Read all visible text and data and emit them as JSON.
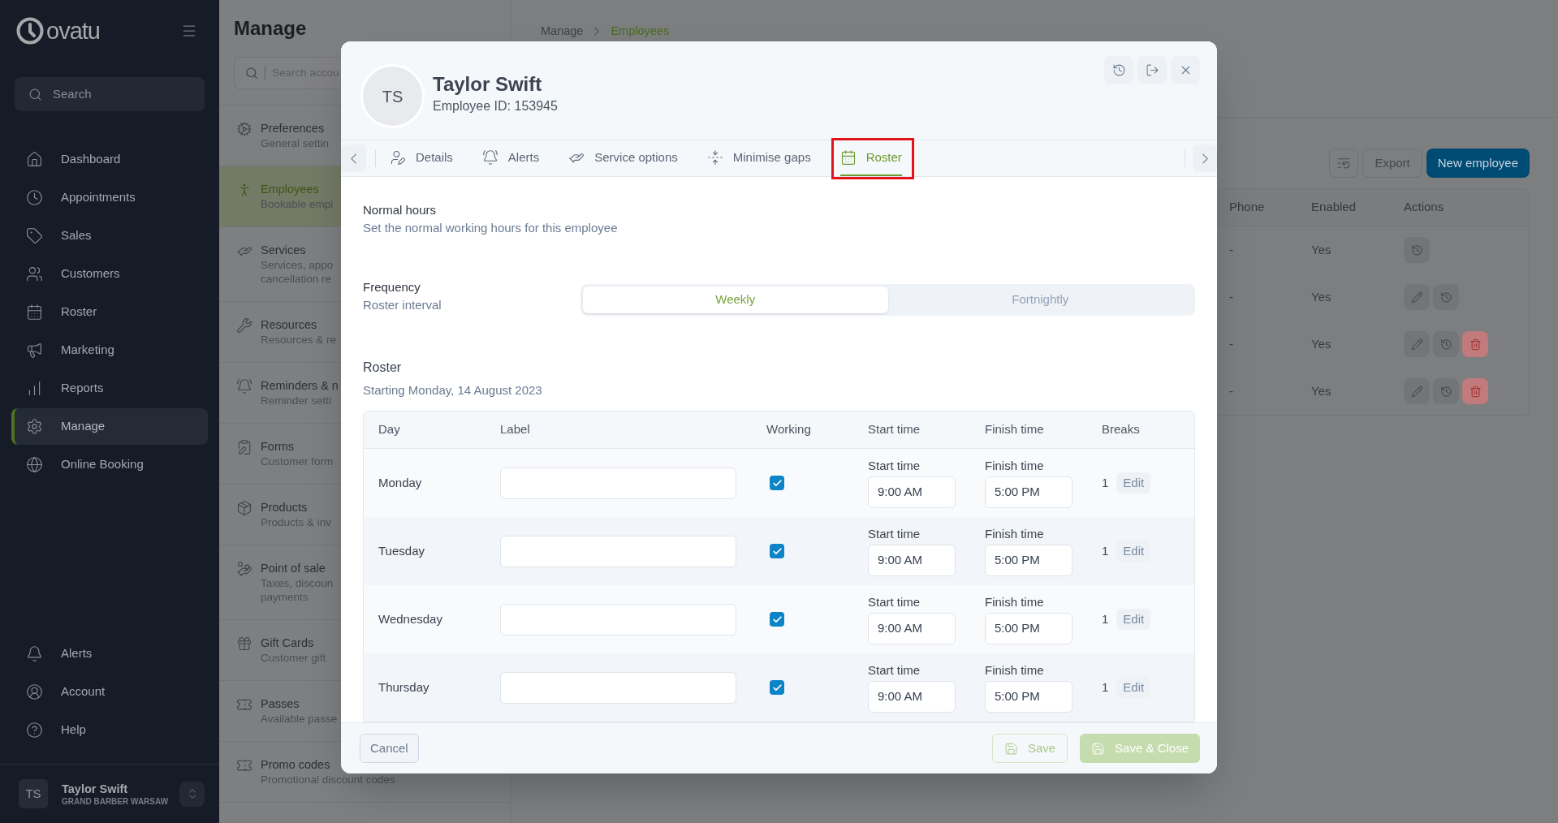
{
  "sidebar": {
    "logo_text": "ovatu",
    "search": {
      "placeholder": "Search"
    },
    "nav_items": [
      {
        "label": "Dashboard",
        "selected": false
      },
      {
        "label": "Appointments",
        "selected": false
      },
      {
        "label": "Sales",
        "selected": false
      },
      {
        "label": "Customers",
        "selected": false
      },
      {
        "label": "Roster",
        "selected": false
      },
      {
        "label": "Marketing",
        "selected": false
      },
      {
        "label": "Reports",
        "selected": false
      },
      {
        "label": "Manage",
        "selected": true
      },
      {
        "label": "Online Booking",
        "selected": false
      }
    ],
    "bottom_items": [
      {
        "label": "Alerts"
      },
      {
        "label": "Account"
      },
      {
        "label": "Help"
      }
    ],
    "user": {
      "initials": "TS",
      "name": "Taylor Swift",
      "business": "GRAND BARBER WARSAW"
    }
  },
  "manage_panel": {
    "title": "Manage",
    "search": {
      "placeholder": "Search accou"
    },
    "items": [
      {
        "title": "Preferences",
        "description": [
          "General settin"
        ],
        "selected": false
      },
      {
        "title": "Employees",
        "description": [
          "Bookable empl"
        ],
        "selected": true
      },
      {
        "title": "Services",
        "description": [
          "Services, appo",
          "cancellation re"
        ],
        "selected": false
      },
      {
        "title": "Resources",
        "description": [
          "Resources & re"
        ],
        "selected": false
      },
      {
        "title": "Reminders & n",
        "description": [
          "Reminder setti"
        ],
        "selected": false
      },
      {
        "title": "Forms",
        "description": [
          "Customer form"
        ],
        "selected": false
      },
      {
        "title": "Products",
        "description": [
          "Products & inv"
        ],
        "selected": false
      },
      {
        "title": "Point of sale",
        "description": [
          "Taxes, discoun",
          "payments"
        ],
        "selected": false
      },
      {
        "title": "Gift Cards",
        "description": [
          "Customer gift"
        ],
        "selected": false
      },
      {
        "title": "Passes",
        "description": [
          "Available passe"
        ],
        "selected": false
      },
      {
        "title": "Promo codes",
        "description": [
          "Promotional discount codes"
        ],
        "selected": false
      }
    ]
  },
  "main": {
    "breadcrumb": [
      {
        "label": "Manage",
        "current": false
      },
      {
        "label": "Employees",
        "current": true
      }
    ],
    "toolbar": [
      {
        "kind": "icon"
      },
      {
        "kind": "outline",
        "label": "Export"
      },
      {
        "kind": "primary",
        "label": "New employee"
      }
    ],
    "table": {
      "columns": [
        "Phone",
        "Enabled",
        "Actions"
      ],
      "rows": [
        {
          "phone": "-",
          "enabled": "Yes",
          "actions": [
            {
              "kind": "history"
            }
          ]
        },
        {
          "phone": "-",
          "enabled": "Yes",
          "actions": [
            {
              "kind": "edit"
            },
            {
              "kind": "history"
            }
          ]
        },
        {
          "phone": "-",
          "enabled": "Yes",
          "actions": [
            {
              "kind": "edit"
            },
            {
              "kind": "history"
            },
            {
              "kind": "delete"
            }
          ]
        },
        {
          "phone": "-",
          "enabled": "Yes",
          "actions": [
            {
              "kind": "edit"
            },
            {
              "kind": "history"
            },
            {
              "kind": "delete"
            }
          ]
        }
      ]
    }
  },
  "dialog": {
    "employee": {
      "initials": "TS",
      "name": "Taylor Swift",
      "id_text": "Employee ID: 153945"
    },
    "tabs": [
      {
        "label": "Details",
        "selected": false,
        "highlighted": false
      },
      {
        "label": "Alerts",
        "selected": false,
        "highlighted": false
      },
      {
        "label": "Service options",
        "selected": false,
        "highlighted": false
      },
      {
        "label": "Minimise gaps",
        "selected": false,
        "highlighted": false
      },
      {
        "label": "Roster",
        "selected": true,
        "highlighted": true
      }
    ],
    "normal_hours": {
      "title": "Normal hours",
      "description": "Set the normal working hours for this employee"
    },
    "frequency": {
      "title": "Frequency",
      "description": "Roster interval",
      "options": [
        {
          "label": "Weekly",
          "selected": true
        },
        {
          "label": "Fortnightly",
          "selected": false
        }
      ]
    },
    "roster": {
      "title": "Roster",
      "subtitle": "Starting Monday, 14 August 2023",
      "columns": [
        "Day",
        "Label",
        "Working",
        "Start time",
        "Finish time",
        "Breaks"
      ],
      "rows": [
        {
          "day": "Monday",
          "working": true,
          "start_label": "Start time",
          "start": "9:00 AM",
          "finish_label": "Finish time",
          "finish": "5:00 PM",
          "breaks": "1",
          "edit": "Edit"
        },
        {
          "day": "Tuesday",
          "working": true,
          "start_label": "Start time",
          "start": "9:00 AM",
          "finish_label": "Finish time",
          "finish": "5:00 PM",
          "breaks": "1",
          "edit": "Edit"
        },
        {
          "day": "Wednesday",
          "working": true,
          "start_label": "Start time",
          "start": "9:00 AM",
          "finish_label": "Finish time",
          "finish": "5:00 PM",
          "breaks": "1",
          "edit": "Edit"
        },
        {
          "day": "Thursday",
          "working": true,
          "start_label": "Start time",
          "start": "9:00 AM",
          "finish_label": "Finish time",
          "finish": "5:00 PM",
          "breaks": "1",
          "edit": "Edit"
        }
      ]
    },
    "footer": {
      "cancel": "Cancel",
      "buttons": [
        {
          "kind": "outline",
          "label": "Save",
          "disabled": true
        },
        {
          "kind": "primary",
          "label": "Save & Close",
          "disabled": true
        }
      ]
    }
  }
}
